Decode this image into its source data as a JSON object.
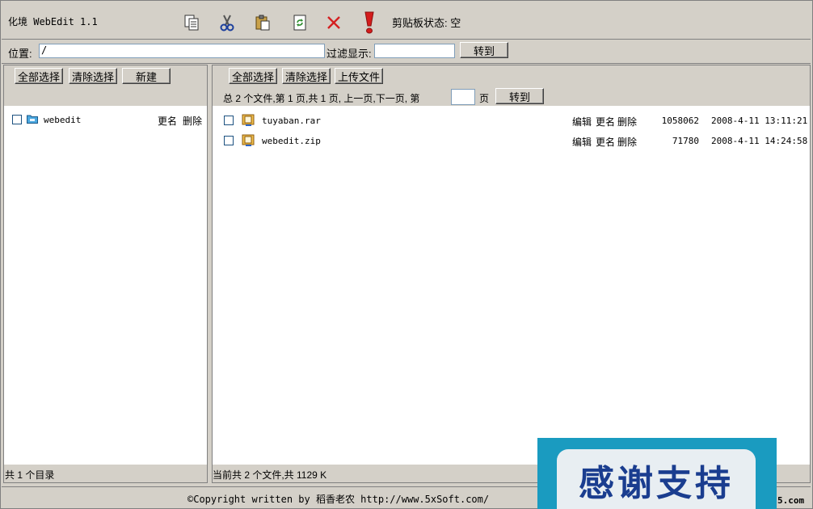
{
  "app": {
    "title": "化境 WebEdit 1.1"
  },
  "toolbar": {
    "icons": [
      "copy-icon",
      "cut-icon",
      "paste-icon",
      "refresh-icon",
      "delete-icon",
      "alert-icon"
    ],
    "clipboard_status": "剪贴板状态: 空"
  },
  "location": {
    "label": "位置:",
    "value": "/",
    "filter_label": "过滤显示:",
    "filter_value": "",
    "go_label": "转到"
  },
  "left": {
    "select_all": "全部选择",
    "clear_select": "清除选择",
    "new": "新建",
    "dirs": [
      {
        "name": "webedit",
        "rename": "更名",
        "delete": "删除"
      }
    ],
    "footer": "共 1 个目录"
  },
  "right": {
    "select_all": "全部选择",
    "clear_select": "清除选择",
    "upload": "上传文件",
    "pager": {
      "text": "总 2 个文件,第 1 页,共 1 页, 上一页,下一页, 第",
      "page_input": "",
      "page_suffix": "页",
      "go": "转到"
    },
    "files": [
      {
        "name": "tuyaban.rar",
        "edit": "编辑",
        "rename": "更名",
        "delete": "删除",
        "size": "1058062",
        "date": "2008-4-11 13:11:21"
      },
      {
        "name": "webedit.zip",
        "edit": "编辑",
        "rename": "更名",
        "delete": "删除",
        "size": "71780",
        "date": "2008-4-11 14:24:58"
      }
    ],
    "footer": "当前共 2 个文件,共 1129 K"
  },
  "status": {
    "copyright": "©Copyright written by 稻香老农 http://www.5xSoft.com/",
    "site_tail": "5.com"
  },
  "banner": {
    "text": "感谢支持"
  }
}
